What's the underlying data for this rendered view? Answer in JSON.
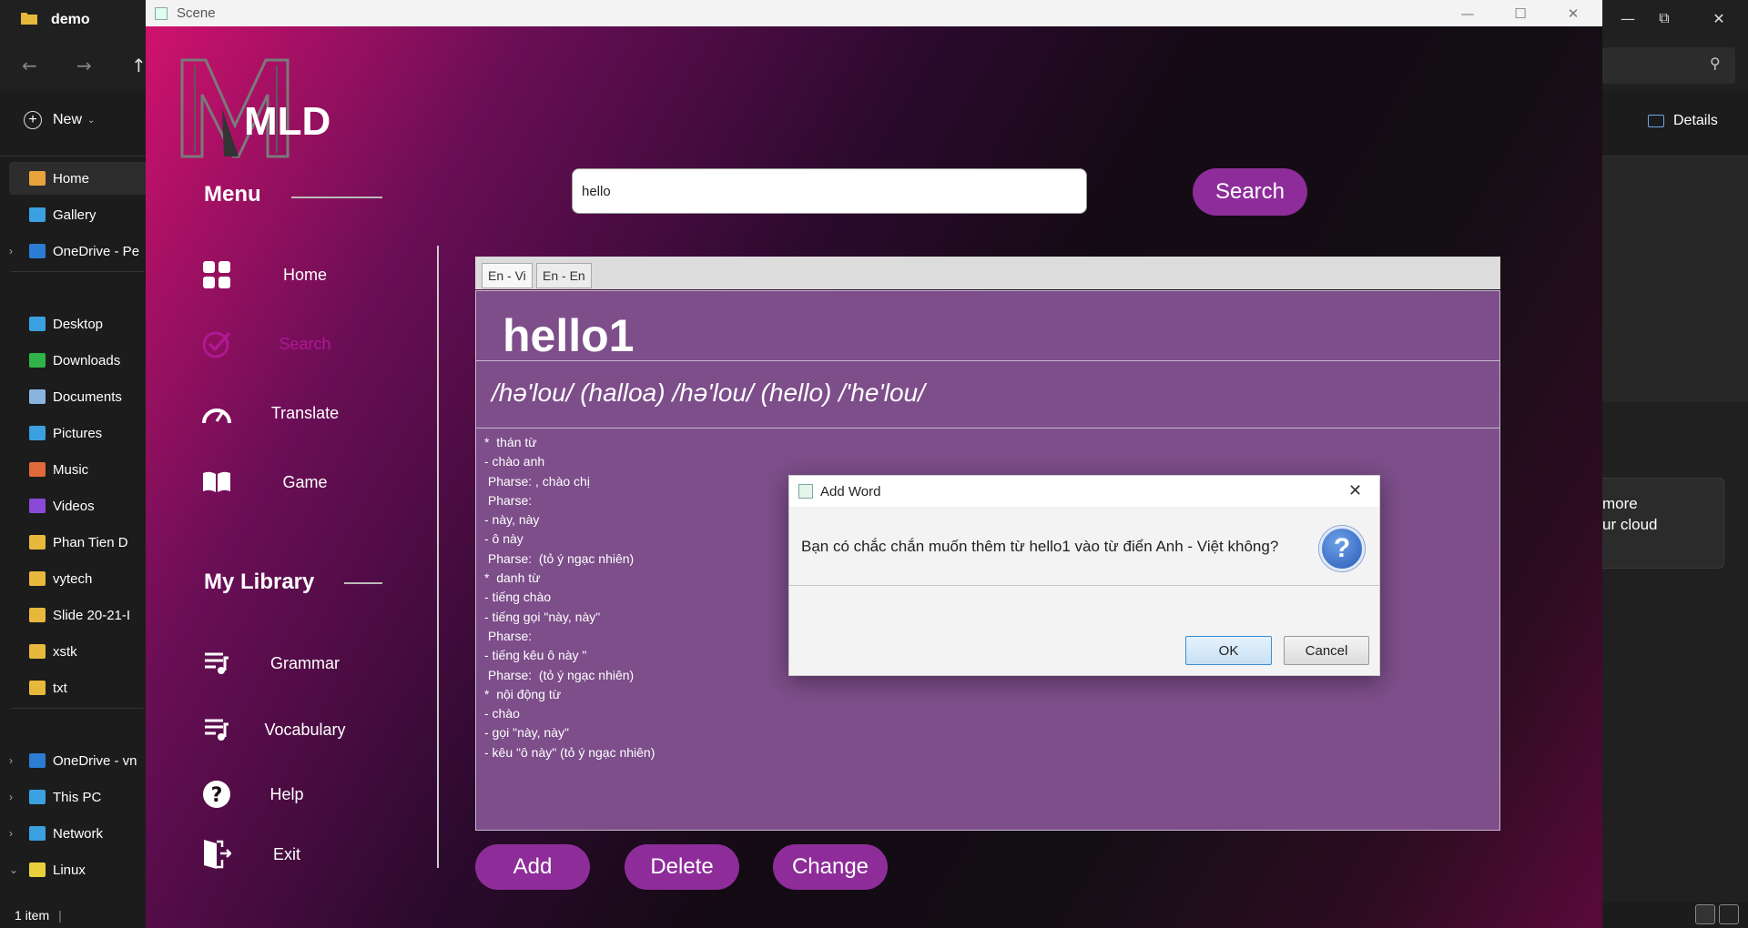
{
  "explorer": {
    "tab_title": "demo",
    "new_label": "New",
    "details_label": "Details",
    "sidebar": [
      {
        "label": "Home",
        "color": "#e8a33d"
      },
      {
        "label": "Gallery",
        "color": "#3aa0e0"
      },
      {
        "label": "OneDrive - Pe",
        "color": "#2b7cd3"
      },
      {
        "label": "Desktop",
        "color": "#3aa0e0"
      },
      {
        "label": "Downloads",
        "color": "#2fb34a"
      },
      {
        "label": "Documents",
        "color": "#8ab4e0"
      },
      {
        "label": "Pictures",
        "color": "#3aa0e0"
      },
      {
        "label": "Music",
        "color": "#e06a3a"
      },
      {
        "label": "Videos",
        "color": "#8a4ad8"
      },
      {
        "label": "Phan Tien D",
        "color": "#e8b83d"
      },
      {
        "label": "vytech",
        "color": "#e8b83d"
      },
      {
        "label": "Slide 20-21-I",
        "color": "#e8b83d"
      },
      {
        "label": "xstk",
        "color": "#e8b83d"
      },
      {
        "label": "txt",
        "color": "#e8b83d"
      },
      {
        "label": "OneDrive - vn",
        "color": "#2b7cd3"
      },
      {
        "label": "This PC",
        "color": "#3aa0e0"
      },
      {
        "label": "Network",
        "color": "#3aa0e0"
      },
      {
        "label": "Linux",
        "color": "#e8d03d"
      }
    ],
    "status": "1 item",
    "promo_line1": "more",
    "promo_line2": "ur cloud"
  },
  "scene": {
    "title": "Scene",
    "logo_text": "MLD",
    "menu_heading": "Menu",
    "library_heading": "My Library",
    "nav": [
      {
        "label": "Home",
        "icon": "grid-icon"
      },
      {
        "label": "Search",
        "icon": "check-circle-icon"
      },
      {
        "label": "Translate",
        "icon": "gauge-icon"
      },
      {
        "label": "Game",
        "icon": "book-icon"
      }
    ],
    "library": [
      {
        "label": "Grammar",
        "icon": "playlist-icon"
      },
      {
        "label": "Vocabulary",
        "icon": "playlist-icon"
      },
      {
        "label": "Help",
        "icon": "help-icon"
      },
      {
        "label": "Exit",
        "icon": "exit-icon"
      }
    ],
    "search_value": "hello",
    "search_button": "Search",
    "tabs": [
      "En - Vi",
      "En - En"
    ],
    "word": "hello1",
    "pronunciation": "/hə'lou/ (halloa) /hə'lou/ (hello) /'he'lou/",
    "definition": "*  thán từ\n- chào anh\n Pharse: , chào chị\n Pharse: \n- này, này\n- ô này\n Pharse:  (tỏ ý ngạc nhiên)\n*  danh từ\n- tiếng chào\n- tiếng gọi \"này, này\"\n Pharse: \n- tiếng kêu ô này \"\n Pharse:  (tỏ ý ngạc nhiên)\n*  nội động từ\n- chào\n- gọi \"này, này\"\n- kêu \"ô này\" (tỏ ý ngạc nhiên)",
    "actions": {
      "add": "Add",
      "delete": "Delete",
      "change": "Change"
    },
    "accent": "#8e2d9a"
  },
  "dialog": {
    "title": "Add Word",
    "message": "Bạn có chắc chắn muốn thêm từ hello1 vào từ điển Anh - Việt không?",
    "ok": "OK",
    "cancel": "Cancel"
  }
}
